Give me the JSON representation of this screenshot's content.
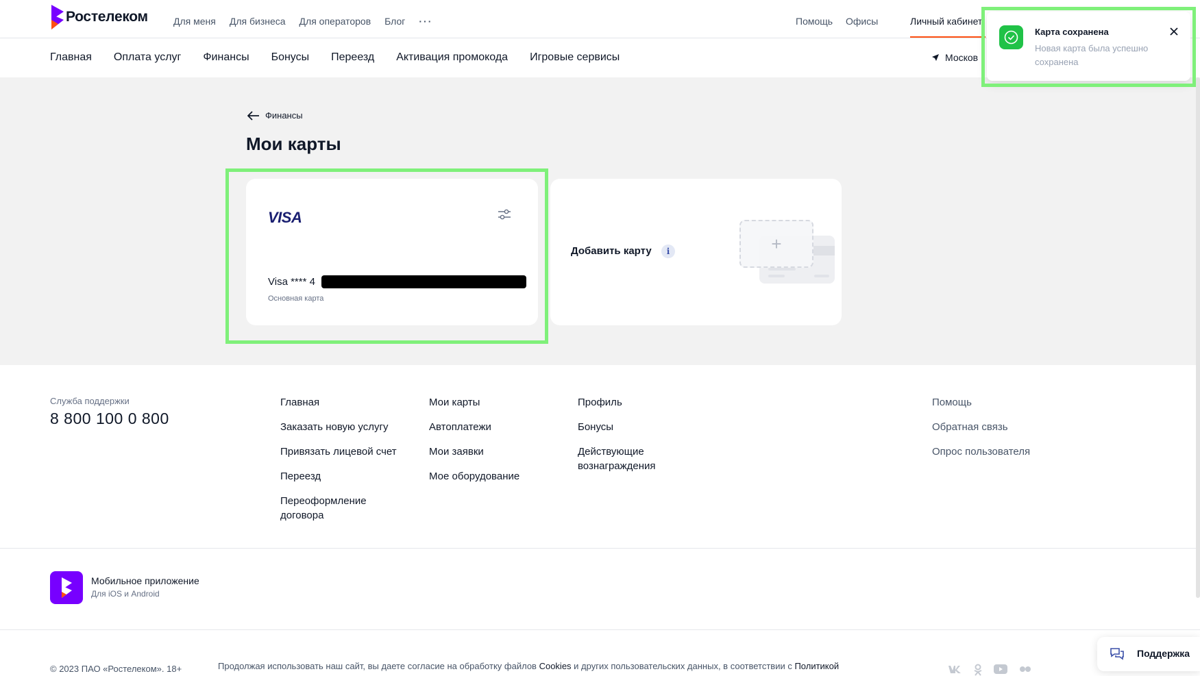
{
  "header": {
    "brand": "Ростелеком",
    "top_nav": [
      "Для меня",
      "Для бизнеса",
      "Для операторов",
      "Блог"
    ],
    "more": "···",
    "help": "Помощь",
    "offices": "Офисы",
    "account": "Личный кабинет"
  },
  "subnav": {
    "items": [
      "Главная",
      "Оплата услуг",
      "Финансы",
      "Бонусы",
      "Переезд",
      "Активация промокода",
      "Игровые сервисы"
    ],
    "location": "Москов"
  },
  "main": {
    "back_label": "Финансы",
    "title": "Мои карты",
    "card": {
      "brand": "VISA",
      "number": "Visa **** 4",
      "subtitle": "Основная карта"
    },
    "add_card": {
      "label": "Добавить карту",
      "info": "i",
      "plus": "+"
    }
  },
  "toast": {
    "title": "Карта сохранена",
    "text": "Новая карта была успешно сохранена",
    "status_color": "#20c247"
  },
  "footer": {
    "support_label": "Служба поддержки",
    "support_phone": "8 800 100 0 800",
    "col1": [
      "Главная",
      "Заказать новую услугу",
      "Привязать лицевой счет",
      "Переезд",
      "Переоформление договора"
    ],
    "col2": [
      "Мои карты",
      "Автоплатежи",
      "Мои заявки",
      "Мое оборудование"
    ],
    "col3": [
      "Профиль",
      "Бонусы",
      "Действующие вознаграждения"
    ],
    "col4": [
      "Помощь",
      "Обратная связь",
      "Опрос пользователя"
    ],
    "app_title": "Мобильное приложение",
    "app_sub": "Для iOS и Android",
    "copyright": "© 2023 ПАО «Ростелеком». 18+",
    "consent_prefix": "Продолжая использовать наш сайт, вы даете согласие на обработку файлов ",
    "consent_cookies": "Cookies",
    "consent_middle": " и других пользовательских данных, в соответствии с ",
    "consent_policy": "Политикой",
    "socials": [
      "vk-icon",
      "ok-icon",
      "youtube-icon",
      "flickr-icon"
    ]
  },
  "support_button": {
    "label": "Поддержка"
  },
  "colors": {
    "brand": "#7700ff",
    "accent": "#ff4f12",
    "highlight": "#7ff07a"
  }
}
